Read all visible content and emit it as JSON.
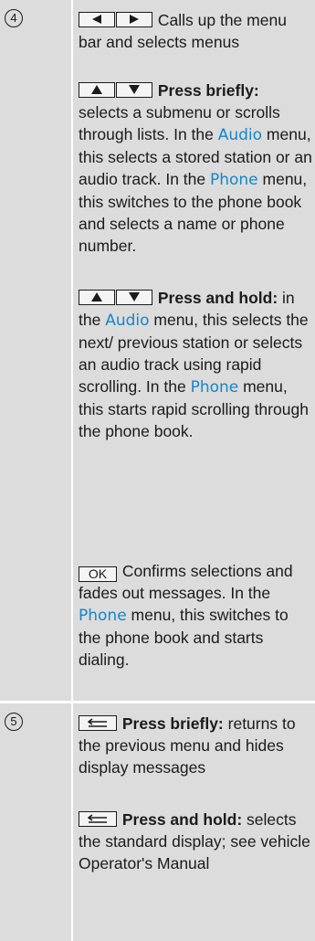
{
  "rows": [
    {
      "number": "4",
      "paragraphs": {
        "lr_text": "Calls up the menu bar and selects menus",
        "updown_brief_bold": "Press briefly:",
        "updown_brief_text1": " selects a submenu or scrolls through lists. In the ",
        "audio": "Audio",
        "updown_brief_text2": " menu, this selects a stored station or an audio track. In the ",
        "phone": "Phone",
        "updown_brief_text3": " menu, this switches to the phone book and selects a name or phone number.",
        "updown_hold_bold": "Press and hold:",
        "updown_hold_text1": " in the ",
        "updown_hold_text2": " menu, this selects the next/ previous station or selects an audio track using rapid scrolling. In the ",
        "updown_hold_text3": " menu, this starts rapid scrolling through the phone book.",
        "ok_key": "OK",
        "ok_text1": " Confirms selections and fades out messages. In the ",
        "ok_text2": " menu, this switches to the phone book and starts dialing."
      }
    },
    {
      "number": "5",
      "paragraphs": {
        "back_brief_bold": "Press briefly:",
        "back_brief_text": " returns to the previous menu and hides display messages",
        "back_hold_bold": "Press and hold:",
        "back_hold_text": " selects the standard display; see vehicle Operator's Manual"
      }
    }
  ],
  "icons": {
    "left_arrow": "left-triangle",
    "right_arrow": "right-triangle",
    "up_arrow": "up-triangle",
    "down_arrow": "down-triangle",
    "back_button": "back-arrow"
  },
  "colors": {
    "cell_bg": "#dcdcdc",
    "display_text": "#1486c9",
    "text": "#1b1b1b"
  }
}
